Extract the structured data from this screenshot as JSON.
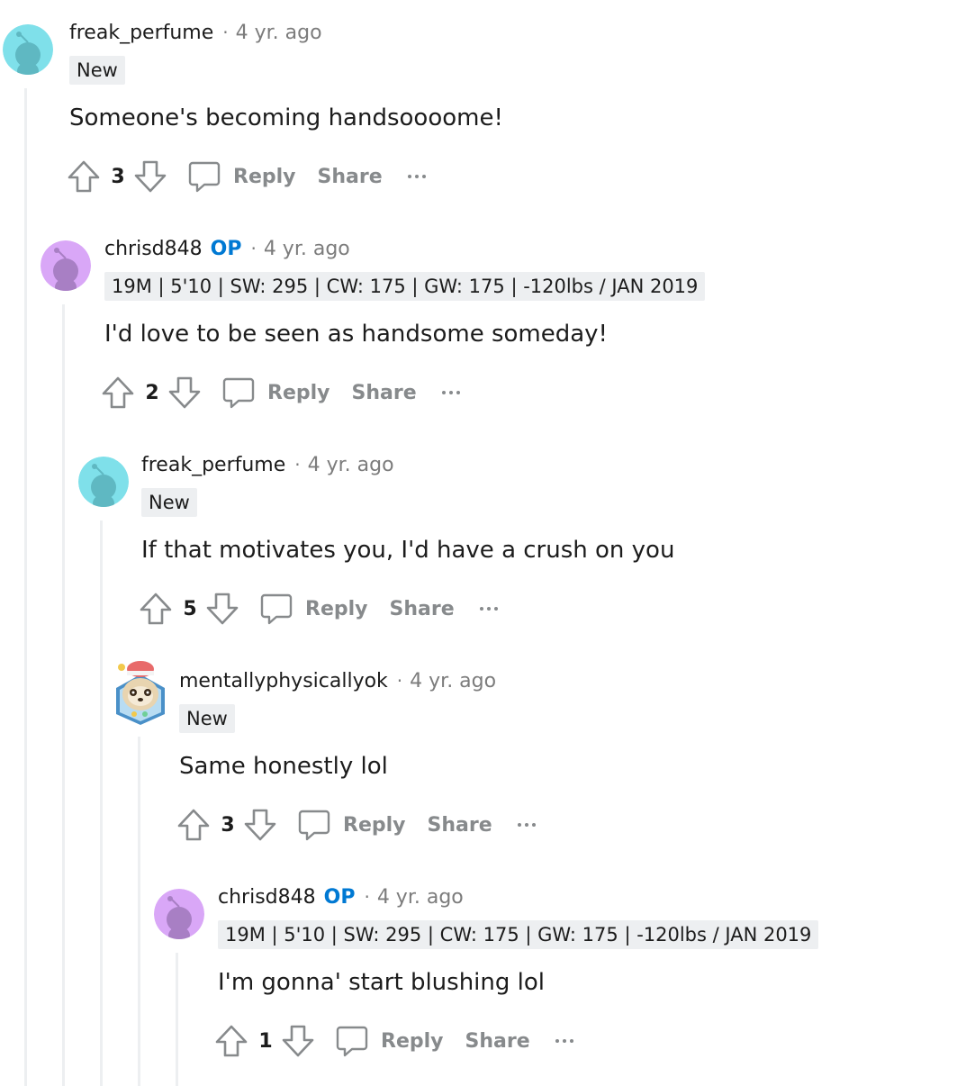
{
  "comments": [
    {
      "username": "freak_perfume",
      "op_badge": "",
      "separator": "·",
      "time": "4 yr. ago",
      "flair": "New",
      "text": "Someone's becoming handsoooome!",
      "score": "3",
      "reply_label": "Reply",
      "share_label": "Share",
      "avatar_color": "#7fe0ea"
    },
    {
      "username": "chrisd848",
      "op_badge": "OP",
      "separator": "·",
      "time": "4 yr. ago",
      "flair": "19M | 5'10 | SW: 295 | CW: 175 | GW: 175 | -120lbs / JAN 2019",
      "text": "I'd love to be seen as handsome someday!",
      "score": "2",
      "reply_label": "Reply",
      "share_label": "Share",
      "avatar_color": "#d9a7f7"
    },
    {
      "username": "freak_perfume",
      "op_badge": "",
      "separator": "·",
      "time": "4 yr. ago",
      "flair": "New",
      "text": "If that motivates you, I'd have a crush on you",
      "score": "5",
      "reply_label": "Reply",
      "share_label": "Share",
      "avatar_color": "#7fe0ea"
    },
    {
      "username": "mentallyphysicallyok",
      "op_badge": "",
      "separator": "·",
      "time": "4 yr. ago",
      "flair": "New",
      "text": "Same honestly lol",
      "score": "3",
      "reply_label": "Reply",
      "share_label": "Share",
      "avatar_color": "#6bb3e0"
    },
    {
      "username": "chrisd848",
      "op_badge": "OP",
      "separator": "·",
      "time": "4 yr. ago",
      "flair": "19M | 5'10 | SW: 295 | CW: 175 | GW: 175 | -120lbs / JAN 2019",
      "text": "I'm gonna' start blushing lol",
      "score": "1",
      "reply_label": "Reply",
      "share_label": "Share",
      "avatar_color": "#d9a7f7"
    }
  ],
  "icons": {
    "upvote": "upvote-icon",
    "downvote": "downvote-icon",
    "reply": "comment-bubble-icon",
    "more": "more-options-icon",
    "avatar": "snoo-avatar-icon"
  },
  "colors": {
    "op_blue": "#0079d3",
    "meta_gray": "#7c7c7c",
    "action_gray": "#878a8c",
    "flair_bg": "#edeff1",
    "thread_line": "#edeff1"
  }
}
